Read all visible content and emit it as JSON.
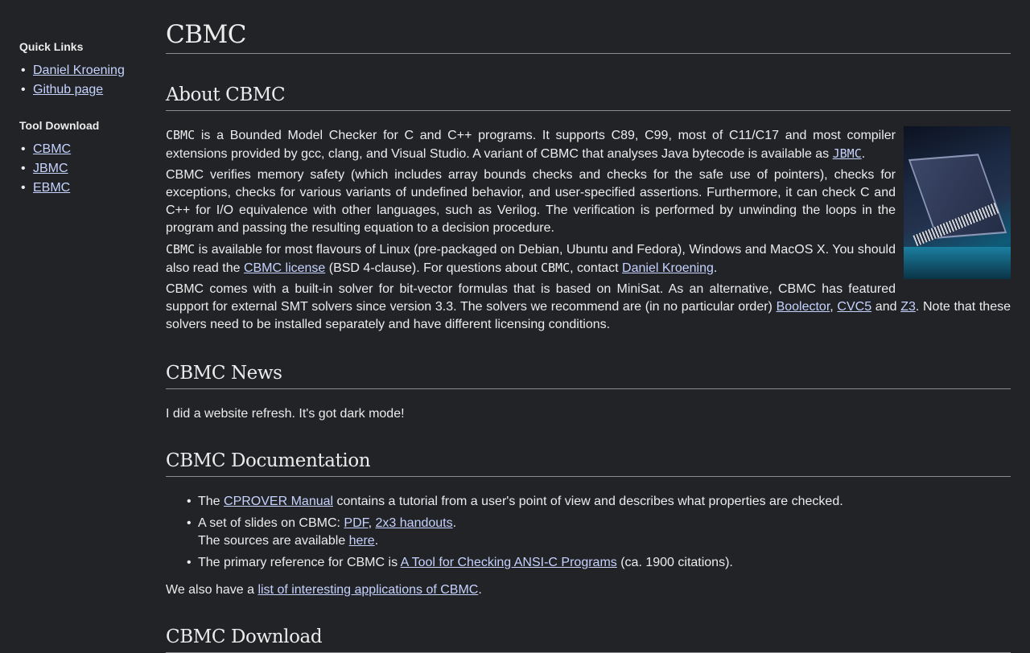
{
  "sidebar": {
    "quick_links_title": "Quick Links",
    "quick_links": [
      {
        "label": "Daniel Kroening"
      },
      {
        "label": "Github page"
      }
    ],
    "tool_download_title": "Tool Download",
    "tool_downloads": [
      {
        "label": "CBMC"
      },
      {
        "label": "JBMC"
      },
      {
        "label": "EBMC"
      }
    ]
  },
  "page": {
    "title": "CBMC"
  },
  "about": {
    "heading": "About CBMC",
    "p1": {
      "cbmc": "CBMC",
      "text1": " is a Bounded Model Checker for C and C++ programs. It supports C89, C99, most of C11/C17 and most compiler extensions provided by gcc, clang, and Visual Studio. A variant of CBMC that analyses Java bytecode is available as ",
      "jbmc_link": "JBMC",
      "text2": "."
    },
    "p2": "CBMC verifies memory safety (which includes array bounds checks and checks for the safe use of pointers), checks for exceptions, checks for various variants of undefined behavior, and user-specified assertions. Furthermore, it can check C and C++ for I/O equivalence with other languages, such as Verilog. The verification is performed by unwinding the loops in the program and passing the resulting equation to a decision procedure.",
    "p3": {
      "cbmc": "CBMC",
      "text1": " is available for most flavours of Linux (pre-packaged on Debian, Ubuntu and Fedora), Windows and MacOS X. You should also read the ",
      "license_link": "CBMC license",
      "text2": " (BSD 4-clause). For questions about ",
      "cbmc2": "CBMC",
      "text3": ", contact ",
      "contact_link": "Daniel Kroening",
      "text4": "."
    },
    "p4": {
      "text1": "CBMC comes with a built-in solver for bit-vector formulas that is based on MiniSat. As an alternative, CBMC has featured support for external SMT solvers since version 3.3. The solvers we recommend are (in no particular order) ",
      "boolector": "Boolector",
      "sep1": ", ",
      "cvc5": "CVC5",
      "sep2": " and ",
      "z3": "Z3",
      "text2": ". Note that these solvers need to be installed separately and have different licensing conditions."
    }
  },
  "news": {
    "heading": "CBMC News",
    "text": "I did a website refresh. It's got dark mode!"
  },
  "docs": {
    "heading": "CBMC Documentation",
    "item1": {
      "text1": "The ",
      "link": "CPROVER Manual",
      "text2": " contains a tutorial from a user's point of view and describes what properties are checked."
    },
    "item2": {
      "text1": "A set of slides on CBMC: ",
      "pdf": "PDF",
      "sep": ", ",
      "handouts": "2x3 handouts",
      "text2": ".",
      "sources_text": "The sources are available ",
      "here": "here",
      "text3": "."
    },
    "item3": {
      "text1": "The primary reference for CBMC is ",
      "link": "A Tool for Checking ANSI-C Programs",
      "text2": " (ca. 1900 citations)."
    },
    "also_text1": "We also have a ",
    "also_link": "list of interesting applications of CBMC",
    "also_text2": "."
  },
  "download": {
    "heading": "CBMC Download"
  },
  "image": {
    "icon": "chip-photo"
  }
}
